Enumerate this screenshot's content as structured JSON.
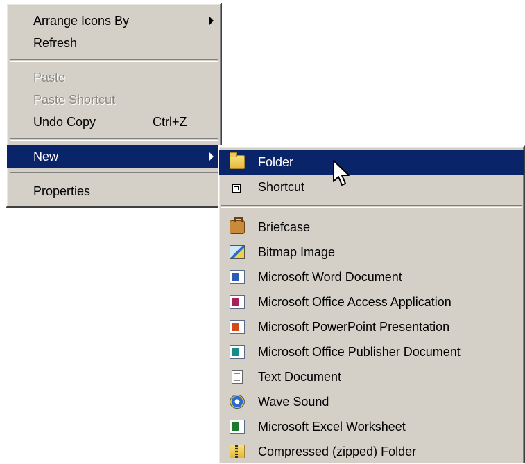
{
  "context_menu": {
    "items": [
      {
        "label": "Arrange Icons By",
        "has_submenu": true
      },
      {
        "label": "Refresh"
      },
      {
        "label": "Paste",
        "disabled": true
      },
      {
        "label": "Paste Shortcut",
        "disabled": true
      },
      {
        "label": "Undo Copy",
        "shortcut": "Ctrl+Z"
      },
      {
        "label": "New",
        "has_submenu": true,
        "selected": true
      },
      {
        "label": "Properties"
      }
    ]
  },
  "new_submenu": {
    "items": [
      {
        "label": "Folder",
        "icon": "folder-icon",
        "selected": true
      },
      {
        "label": "Shortcut",
        "icon": "shortcut-icon"
      },
      {
        "label": "Briefcase",
        "icon": "briefcase-icon"
      },
      {
        "label": "Bitmap Image",
        "icon": "bitmap-icon"
      },
      {
        "label": "Microsoft Word Document",
        "icon": "word-document-icon"
      },
      {
        "label": "Microsoft Office Access Application",
        "icon": "access-icon"
      },
      {
        "label": "Microsoft PowerPoint Presentation",
        "icon": "powerpoint-icon"
      },
      {
        "label": "Microsoft Office Publisher Document",
        "icon": "publisher-icon"
      },
      {
        "label": "Text Document",
        "icon": "text-document-icon"
      },
      {
        "label": "Wave Sound",
        "icon": "wave-sound-icon"
      },
      {
        "label": "Microsoft Excel Worksheet",
        "icon": "excel-icon"
      },
      {
        "label": "Compressed (zipped) Folder",
        "icon": "zip-folder-icon"
      }
    ]
  },
  "colors": {
    "menu_bg": "#d4d0c8",
    "highlight": "#0a246a",
    "disabled_text": "#8a8880"
  }
}
